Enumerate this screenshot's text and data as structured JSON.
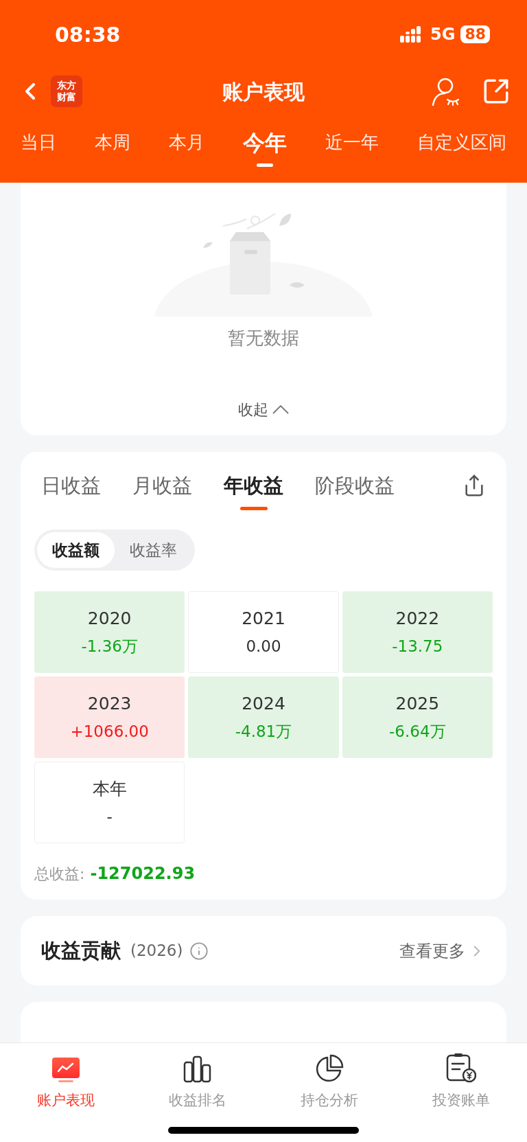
{
  "status_bar": {
    "time": "08:38",
    "network": "5G",
    "battery": "88"
  },
  "header": {
    "logo": "东方财富",
    "title": "账户表现"
  },
  "period_tabs": [
    {
      "label": "当日",
      "selected": false
    },
    {
      "label": "本周",
      "selected": false
    },
    {
      "label": "本月",
      "selected": false
    },
    {
      "label": "今年",
      "selected": true
    },
    {
      "label": "近一年",
      "selected": false
    },
    {
      "label": "自定义区间",
      "selected": false
    }
  ],
  "empty_card": {
    "message": "暂无数据",
    "collapse": "收起"
  },
  "earnings_card": {
    "tabs": [
      {
        "label": "日收益",
        "selected": false
      },
      {
        "label": "月收益",
        "selected": false
      },
      {
        "label": "年收益",
        "selected": true
      },
      {
        "label": "阶段收益",
        "selected": false
      }
    ],
    "toggle": [
      {
        "label": "收益额",
        "selected": true
      },
      {
        "label": "收益率",
        "selected": false
      }
    ],
    "cells": [
      {
        "year": "2020",
        "value": "-1.36万",
        "kind": "loss"
      },
      {
        "year": "2021",
        "value": "0.00",
        "kind": "flat"
      },
      {
        "year": "2022",
        "value": "-13.75",
        "kind": "loss"
      },
      {
        "year": "2023",
        "value": "+1066.00",
        "kind": "gain"
      },
      {
        "year": "2024",
        "value": "-4.81万",
        "kind": "loss"
      },
      {
        "year": "2025",
        "value": "-6.64万",
        "kind": "loss"
      },
      {
        "year": "本年",
        "value": "-",
        "kind": "flat"
      }
    ],
    "total_label": "总收益:",
    "total_value": "-127022.93"
  },
  "contribution_card": {
    "title": "收益贡献",
    "year": "(2026)",
    "more": "查看更多"
  },
  "bottom_nav": [
    {
      "label": "账户表现",
      "selected": true
    },
    {
      "label": "收益排名",
      "selected": false
    },
    {
      "label": "持仓分析",
      "selected": false
    },
    {
      "label": "投资账单",
      "selected": false
    }
  ]
}
